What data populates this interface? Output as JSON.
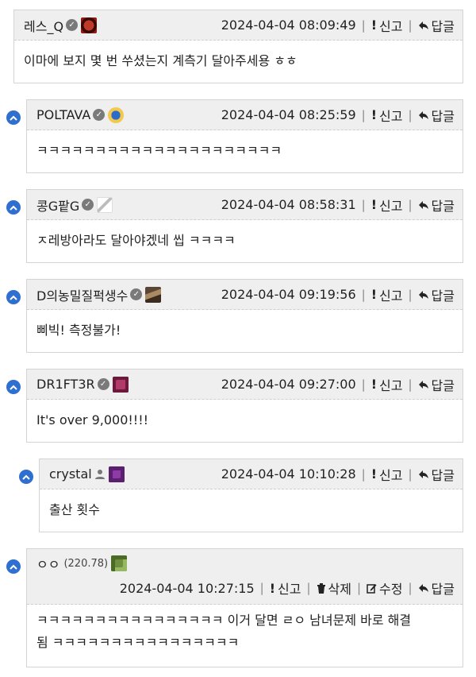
{
  "actions": {
    "report_label": "신고",
    "reply_label": "답글",
    "delete_label": "삭제",
    "edit_label": "수정"
  },
  "comments": [
    {
      "author": "레스_Q",
      "timestamp": "2024-04-04 08:09:49",
      "text": "이마에 보지 몇 번 쑤셨는지 계측기 달아주세용 ㅎㅎ",
      "level_icon": "red-emblem-icon"
    },
    {
      "author": "POLTAVA",
      "timestamp": "2024-04-04 08:25:59",
      "text": "ㅋㅋㅋㅋㅋㅋㅋㅋㅋㅋㅋㅋㅋㅋㅋㅋㅋㅋㅋㅋㅋ",
      "level_icon": "trident-emblem-icon"
    },
    {
      "author": "콩G팥G",
      "timestamp": "2024-04-04 08:58:31",
      "text": "ㅈ레방아라도 달아야겠네 씹 ㅋㅋㅋㅋ",
      "level_icon": "sketch-figure-icon"
    },
    {
      "author": "D의농밀질퍽생수",
      "timestamp": "2024-04-04 09:19:56",
      "text": "삐빅! 측정불가!",
      "level_icon": "brown-portrait-icon"
    },
    {
      "author": "DR1FT3R",
      "timestamp": "2024-04-04 09:27:00",
      "text": "It's over 9,000!!!!",
      "level_icon": "pixel-skull-icon"
    },
    {
      "author": "crystal",
      "timestamp": "2024-04-04 10:10:28",
      "text": "출산 횟수",
      "level_icon": "pixel-creeper-icon"
    },
    {
      "author": "ㅇㅇ",
      "points": "(220.78)",
      "timestamp": "2024-04-04 10:27:15",
      "text": "ㅋㅋㅋㅋㅋㅋㅋㅋㅋㅋㅋㅋㅋㅋㅋㅋ 이거 달면 ㄹㅇ 남녀문제 바로 해결",
      "text_line2": "됨 ㅋㅋㅋㅋㅋㅋㅋㅋㅋㅋㅋㅋㅋㅋㅋㅋ",
      "level_icon": "green-pixel-icon"
    }
  ]
}
